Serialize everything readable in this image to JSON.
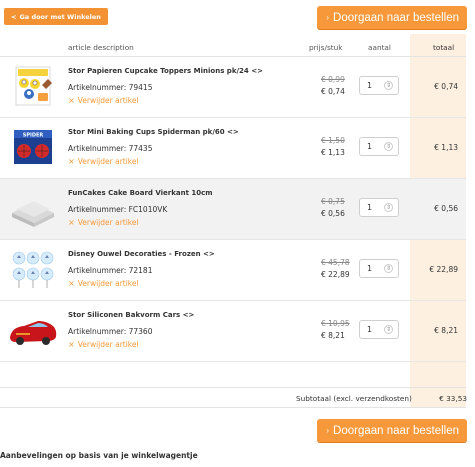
{
  "nav": {
    "back_arrow": "<",
    "back_label": "Ga door met Winkelen",
    "checkout_label": "Doorgaan naar bestellen",
    "checkout_chevron": "›"
  },
  "table": {
    "headers": {
      "description": "article description",
      "price": "prijs/stuk",
      "quantity": "aantal",
      "total": "totaal"
    },
    "remove_label": "Verwijder artikel",
    "remove_icon": "×",
    "items": [
      {
        "name": "Stor Papieren Cupcake Toppers Minions pk/24 <>",
        "sku_label": "Artikelnummer: 79415",
        "old_price": "€ 0,99",
        "price": "€ 0,74",
        "quantity": "1",
        "total": "€ 0,74",
        "thumb": "minions-toppers"
      },
      {
        "name": "Stor Mini Baking Cups Spiderman pk/60 <>",
        "sku_label": "Artikelnummer: 77435",
        "old_price": "€ 1,50",
        "price": "€ 1,13",
        "quantity": "1",
        "total": "€ 1,13",
        "thumb": "spiderman-cups"
      },
      {
        "name": "FunCakes Cake Board Vierkant 10cm",
        "sku_label": "Artikelnummer: FC1010VK",
        "old_price": "€ 0,75",
        "price": "€ 0,56",
        "quantity": "1",
        "total": "€ 0,56",
        "thumb": "cake-board"
      },
      {
        "name": "Disney Ouwel Decoraties - Frozen <>",
        "sku_label": "Artikelnummer: 72181",
        "old_price": "€ 45,78",
        "price": "€ 22,89",
        "quantity": "1",
        "total": "€ 22,89",
        "thumb": "frozen-decorations"
      },
      {
        "name": "Stor Siliconen Bakvorm Cars <>",
        "sku_label": "Artikelnummer: 77360",
        "old_price": "€ 10,95",
        "price": "€ 8,21",
        "quantity": "1",
        "total": "€ 8,21",
        "thumb": "cars-baking-mold"
      }
    ],
    "subtotal_label": "Subtotaal (excl. verzendkosten)",
    "subtotal_value": "€ 33,53"
  },
  "recommendations_title": "Aanbevelingen op basis van je winkelwagentje",
  "colors": {
    "accent": "#f7993a",
    "total_column": "#fdf0e0",
    "remove_link": "#f39a3a"
  }
}
